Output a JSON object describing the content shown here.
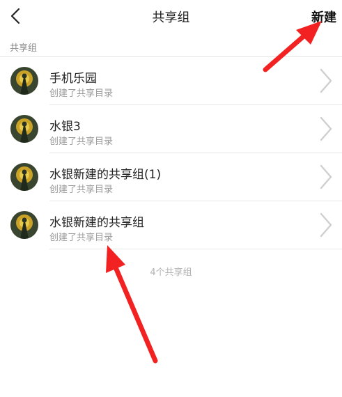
{
  "header": {
    "back_icon": "chevron-left-icon",
    "title": "共享组",
    "new_label": "新建"
  },
  "section": {
    "label": "共享组"
  },
  "groups": [
    {
      "name": "手机乐园",
      "subtitle": "创建了共享目录"
    },
    {
      "name": "水银3",
      "subtitle": "创建了共享目录"
    },
    {
      "name": "水银新建的共享组(1)",
      "subtitle": "创建了共享目录"
    },
    {
      "name": "水银新建的共享组",
      "subtitle": "创建了共享目录"
    }
  ],
  "footer": {
    "count_text": "4个共享组"
  },
  "colors": {
    "annotation_arrow": "#f22222",
    "divider": "#e6e6e6",
    "secondary_text": "#9a9a9a"
  }
}
